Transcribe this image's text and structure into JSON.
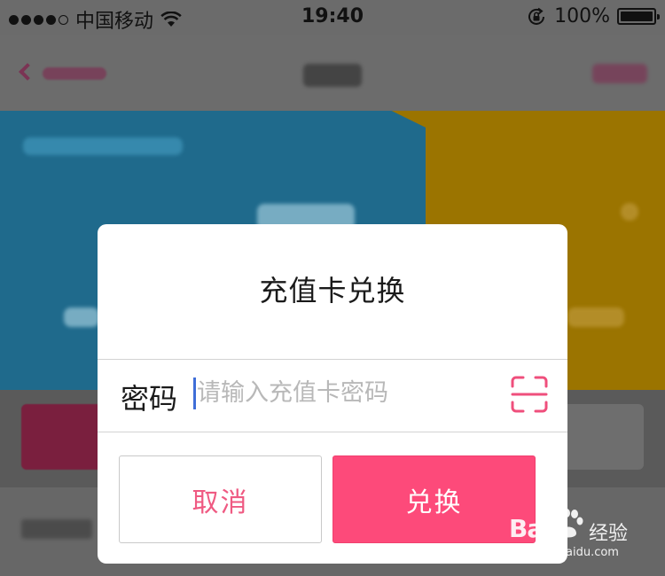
{
  "statusbar": {
    "carrier": "中国移动",
    "time": "19:40",
    "battery_pct": "100%",
    "signal_bars": 4,
    "signal_total": 5
  },
  "dialog": {
    "title": "充值卡兑换",
    "password_label": "密码",
    "password_value": "",
    "password_placeholder": "请输入充值卡密码",
    "cancel_label": "取消",
    "redeem_label": "兑换"
  },
  "colors": {
    "accent": "#fd4a7a",
    "cancel_text": "#ef5a82",
    "caret": "#3f6ed8",
    "overlay_dim": "#6c6c6c"
  },
  "icons": {
    "status_wifi": "wifi-icon",
    "status_lock": "rotation-lock-icon",
    "status_battery": "battery-icon",
    "scan": "scan-icon"
  },
  "watermark": {
    "logo": "Bai",
    "brand_cn": "经验",
    "url": "jingyan.baidu.com"
  }
}
